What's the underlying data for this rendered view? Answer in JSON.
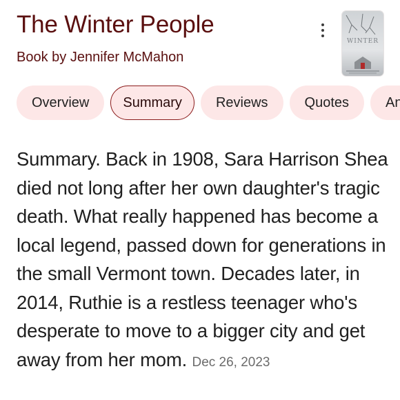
{
  "book": {
    "title": "The Winter People",
    "subtitle": "Book by Jennifer McMahon",
    "cover_text": "WINTER"
  },
  "menu": {
    "icon": "more-vert-icon"
  },
  "tabs": [
    {
      "label": "Overview",
      "active": false
    },
    {
      "label": "Summary",
      "active": true
    },
    {
      "label": "Reviews",
      "active": false
    },
    {
      "label": "Quotes",
      "active": false
    },
    {
      "label": "Ana",
      "active": false
    }
  ],
  "summary": {
    "text": "Summary. Back in 1908, Sara Harrison Shea died not long after her own daughter's tragic death. What really happened has become a local legend, passed down for generations in the small Vermont town. Decades later, in 2014, Ruthie is a restless teenager who's desperate to move to a bigger city and get away from her mom.",
    "date": "Dec 26, 2023"
  },
  "colors": {
    "title": "#5a0f0f",
    "chip_bg": "#fde7e7",
    "chip_active_border": "#8a1a1a"
  }
}
